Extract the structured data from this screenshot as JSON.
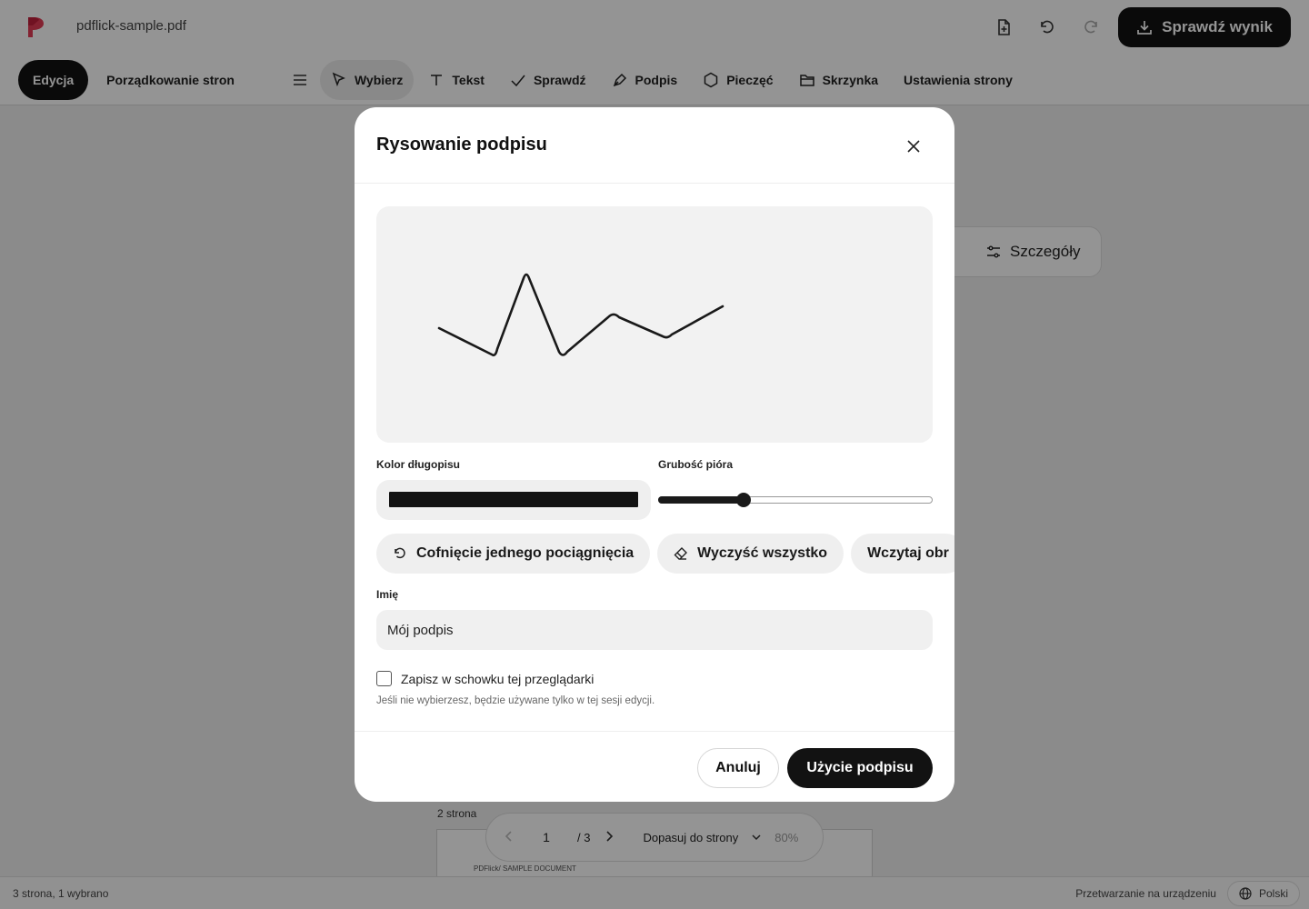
{
  "app": {
    "filename": "pdflick-sample.pdf",
    "download_button": "Sprawdź wynik",
    "brand_color": "#e23b55",
    "icons": {
      "new_document": "file-plus-icon",
      "undo": "undo-icon",
      "redo": "redo-icon"
    }
  },
  "toolbar": {
    "modes": [
      "Edycja",
      "Porządkowanie stron"
    ],
    "active_mode": "Edycja",
    "tools": [
      {
        "label": "Wybierz",
        "icon": "cursor-icon",
        "active": true
      },
      {
        "label": "Tekst",
        "icon": "text-icon"
      },
      {
        "label": "Sprawdź",
        "icon": "check-icon"
      },
      {
        "label": "Podpis",
        "icon": "pen-icon"
      },
      {
        "label": "Pieczęć",
        "icon": "stamp-icon"
      },
      {
        "label": "Skrzynka",
        "icon": "folder-icon"
      },
      {
        "label": "Ustawienia strony",
        "icon": ""
      }
    ]
  },
  "canvas": {
    "details_button": "Szczegóły",
    "page_label": "2 strona",
    "page_header_text": "PDFlick/ SAMPLE DOCUMENT"
  },
  "pager": {
    "current_page": "1",
    "total": "/ 3",
    "fit_mode": "Dopasuj do strony",
    "zoom": "80%"
  },
  "status": {
    "selection": "3 strona, 1 wybrano",
    "processing": "Przetwarzanie na urządzeniu",
    "language": "Polski"
  },
  "modal": {
    "title": "Rysowanie podpisu",
    "signature_stroke_color": "#1a1a1a",
    "pen_color_label": "Kolor długopisu",
    "pen_color_value": "#121212",
    "pen_width_label": "Grubość pióra",
    "pen_width_fraction": 0.31,
    "undo_stroke": "Cofnięcie jednego pociągnięcia",
    "clear_all": "Wyczyść wszystko",
    "load_image": "Wczytaj obr",
    "name_label": "Imię",
    "name_value": "Mój podpis",
    "save_checkbox_label": "Zapisz w schowku tej przeglądarki",
    "save_checked": false,
    "hint": "Jeśli nie wybierzesz, będzie używane tylko w tej sesji edycji.",
    "cancel": "Anuluj",
    "confirm": "Użycie podpisu"
  }
}
